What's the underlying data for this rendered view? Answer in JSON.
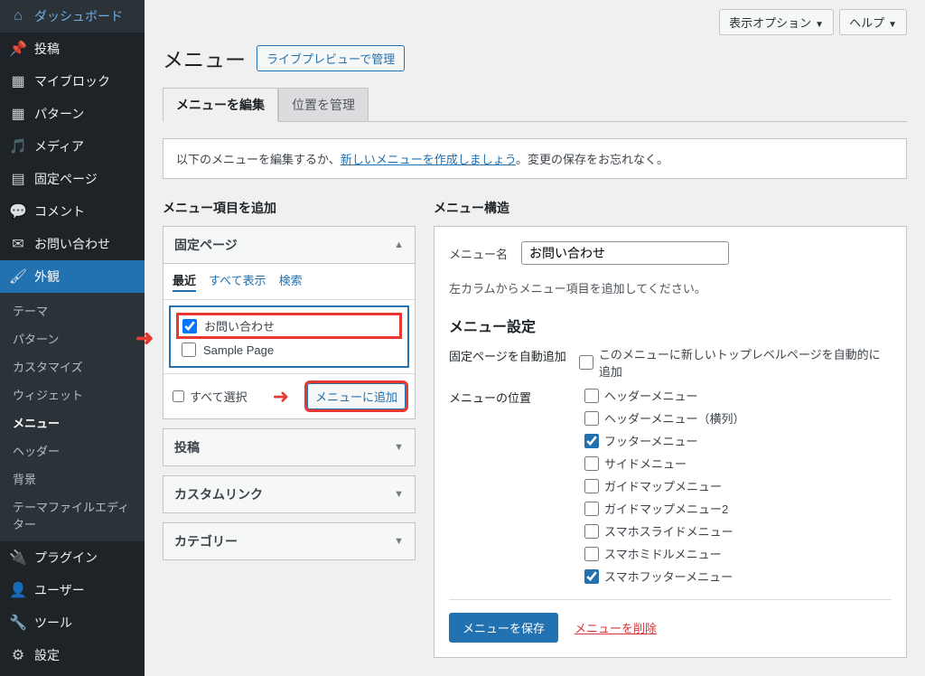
{
  "topbar": {
    "screen_options": "表示オプション",
    "help": "ヘルプ"
  },
  "header": {
    "title": "メニュー",
    "live_preview": "ライブプレビューで管理"
  },
  "tabs": {
    "edit": "メニューを編集",
    "locations": "位置を管理"
  },
  "notice": {
    "prefix": "以下のメニューを編集するか、",
    "link": "新しいメニューを作成しましょう",
    "suffix": "。変更の保存をお忘れなく。"
  },
  "sidebar": {
    "items": [
      {
        "label": "ダッシュボード",
        "icon": "dashboard"
      },
      {
        "label": "投稿",
        "icon": "pin"
      },
      {
        "label": "マイブロック",
        "icon": "grid"
      },
      {
        "label": "パターン",
        "icon": "grid"
      },
      {
        "label": "メディア",
        "icon": "media"
      },
      {
        "label": "固定ページ",
        "icon": "page"
      },
      {
        "label": "コメント",
        "icon": "comment"
      },
      {
        "label": "お問い合わせ",
        "icon": "mail"
      },
      {
        "label": "外観",
        "icon": "brush",
        "active": true
      },
      {
        "label": "プラグイン",
        "icon": "plug"
      },
      {
        "label": "ユーザー",
        "icon": "user"
      },
      {
        "label": "ツール",
        "icon": "wrench"
      },
      {
        "label": "設定",
        "icon": "gear"
      }
    ],
    "submenu": [
      "テーマ",
      "パターン",
      "カスタマイズ",
      "ウィジェット",
      "メニュー",
      "ヘッダー",
      "背景",
      "テーマファイルエディター"
    ],
    "submenu_current": "メニュー"
  },
  "add_items": {
    "heading": "メニュー項目を追加",
    "pages": {
      "title": "固定ページ",
      "subtabs": {
        "recent": "最近",
        "all": "すべて表示",
        "search": "検索"
      },
      "items": [
        {
          "label": "お問い合わせ",
          "checked": true
        },
        {
          "label": "Sample Page",
          "checked": false
        }
      ],
      "select_all": "すべて選択",
      "add_btn": "メニューに追加"
    },
    "posts": "投稿",
    "custom_links": "カスタムリンク",
    "categories": "カテゴリー"
  },
  "structure": {
    "heading": "メニュー構造",
    "name_label": "メニュー名",
    "name_value": "お問い合わせ",
    "empty_hint": "左カラムからメニュー項目を追加してください。",
    "settings_heading": "メニュー設定",
    "auto_add_label": "固定ページを自動追加",
    "auto_add_check": "このメニューに新しいトップレベルページを自動的に追加",
    "location_label": "メニューの位置",
    "locations": [
      {
        "label": "ヘッダーメニュー",
        "checked": false
      },
      {
        "label": "ヘッダーメニュー（横列）",
        "checked": false
      },
      {
        "label": "フッターメニュー",
        "checked": true
      },
      {
        "label": "サイドメニュー",
        "checked": false
      },
      {
        "label": "ガイドマップメニュー",
        "checked": false
      },
      {
        "label": "ガイドマップメニュー2",
        "checked": false
      },
      {
        "label": "スマホスライドメニュー",
        "checked": false
      },
      {
        "label": "スマホミドルメニュー",
        "checked": false
      },
      {
        "label": "スマホフッターメニュー",
        "checked": true
      }
    ],
    "save_btn": "メニューを保存",
    "delete_link": "メニューを削除"
  }
}
